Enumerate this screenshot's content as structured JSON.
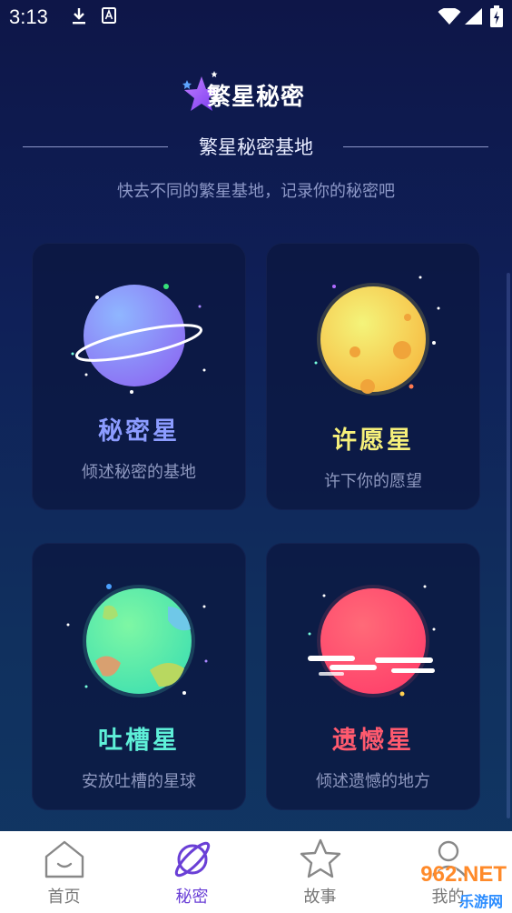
{
  "status": {
    "time": "3:13"
  },
  "header": {
    "logo_text": "繁星秘密",
    "title": "繁星秘密基地",
    "subtitle": "快去不同的繁星基地，记录你的秘密吧"
  },
  "cards": [
    {
      "name": "秘密星",
      "desc": "倾述秘密的基地",
      "color": "#8c9cff"
    },
    {
      "name": "许愿星",
      "desc": "许下你的愿望",
      "color": "#f6f07a"
    },
    {
      "name": "吐槽星",
      "desc": "安放吐槽的星球",
      "color": "#5ef0c0"
    },
    {
      "name": "遗憾星",
      "desc": "倾述遗憾的地方",
      "color": "#ff5a6e"
    }
  ],
  "tabs": [
    {
      "label": "首页"
    },
    {
      "label": "秘密"
    },
    {
      "label": "故事"
    },
    {
      "label": "我的"
    }
  ],
  "watermark": {
    "brand": "962.NET",
    "sub": "乐游网"
  },
  "colors": {
    "accent": "#6a3fd6",
    "background_top": "#0e1648",
    "background_bottom": "#113764"
  }
}
